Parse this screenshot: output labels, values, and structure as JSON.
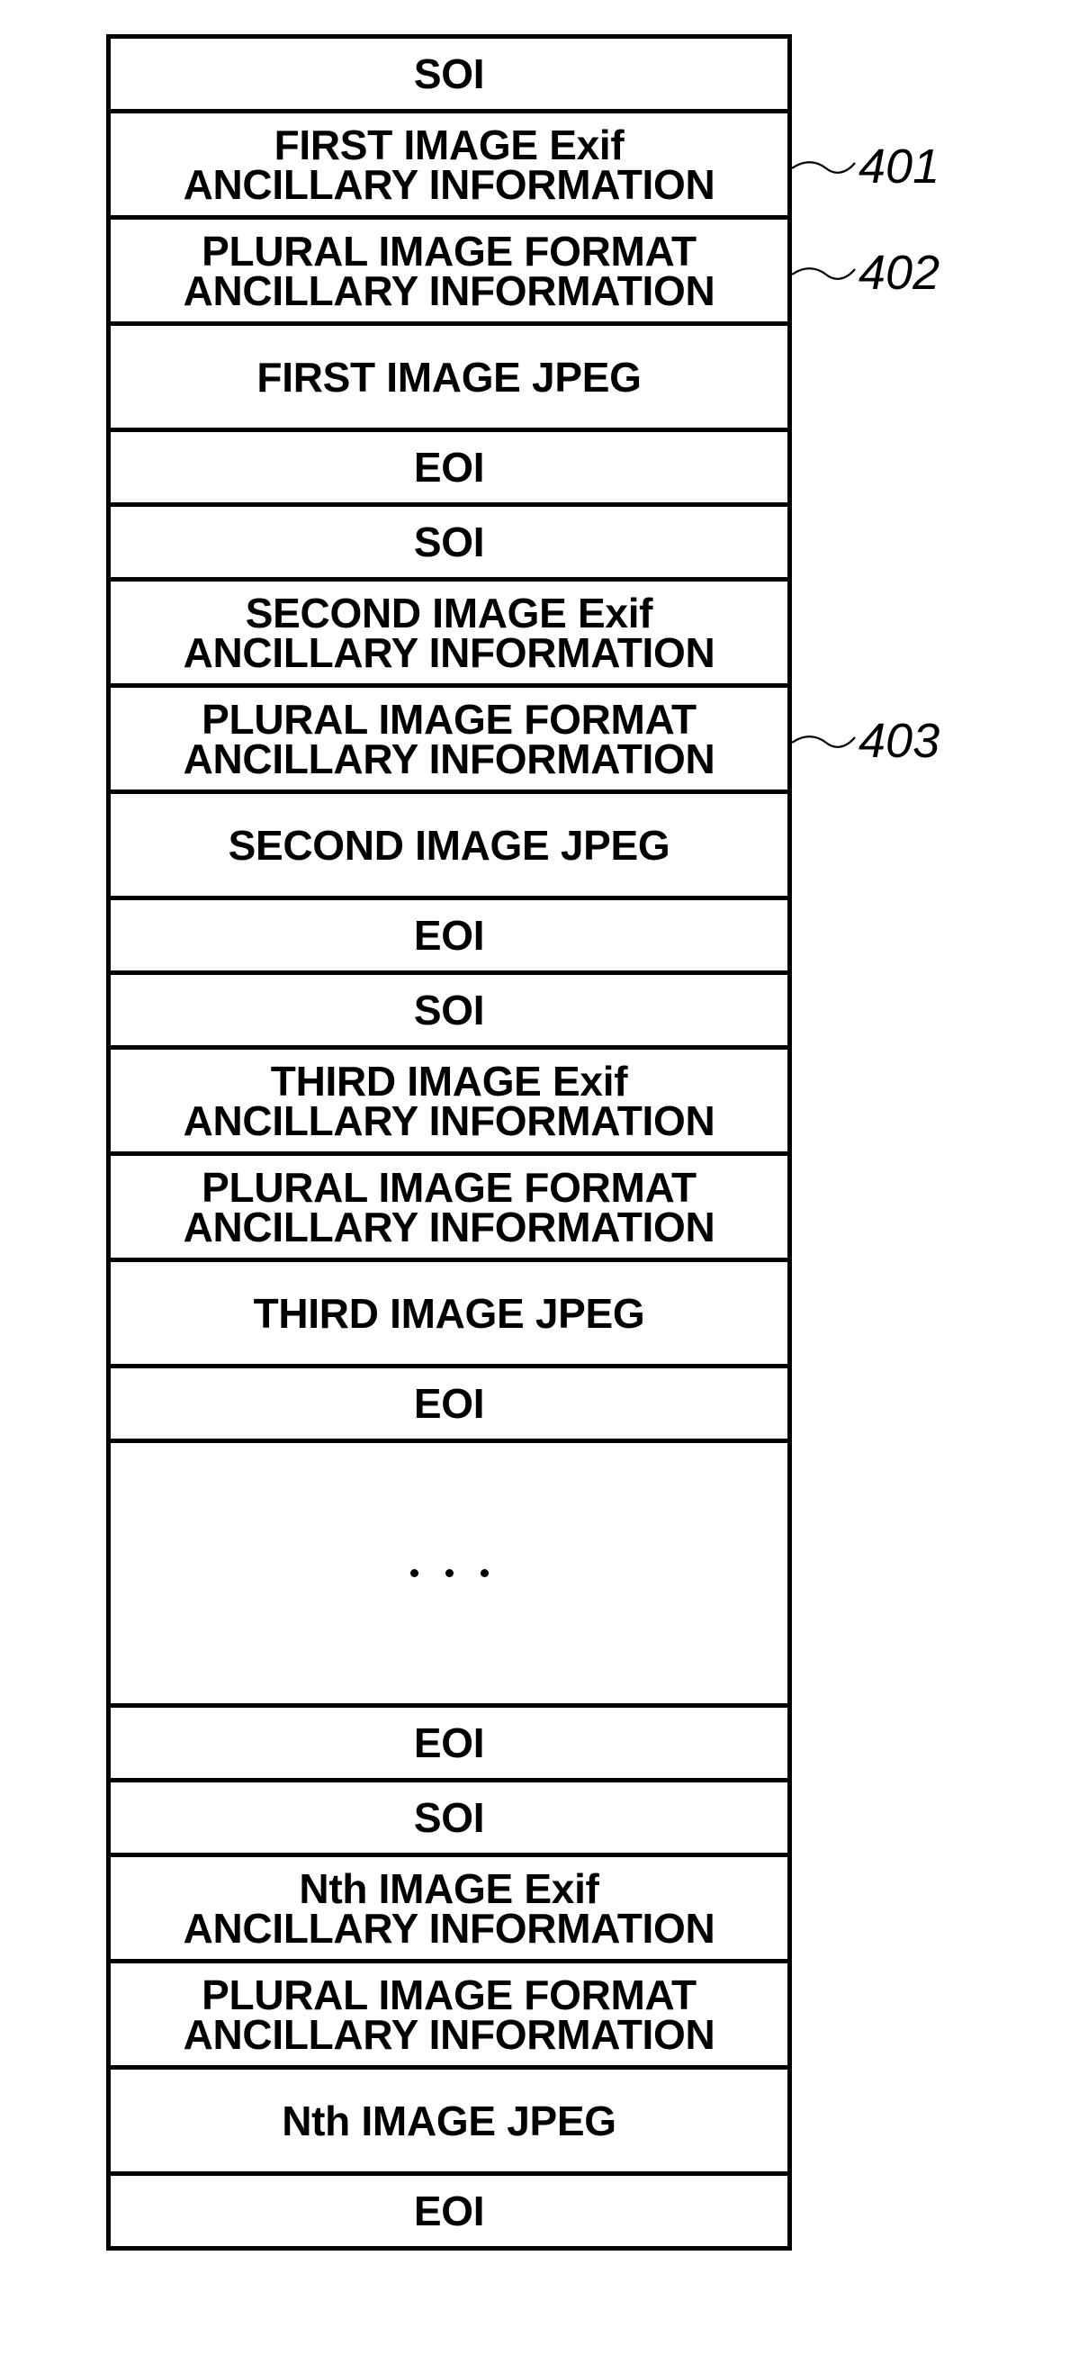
{
  "diagram": {
    "rows": [
      {
        "type": "short",
        "lines": [
          "SOI"
        ]
      },
      {
        "type": "tall",
        "lines": [
          "FIRST IMAGE Exif",
          "ANCILLARY INFORMATION"
        ]
      },
      {
        "type": "tall",
        "lines": [
          "PLURAL IMAGE FORMAT",
          "ANCILLARY INFORMATION"
        ]
      },
      {
        "type": "tall",
        "lines": [
          "FIRST IMAGE JPEG"
        ]
      },
      {
        "type": "short",
        "lines": [
          "EOI"
        ]
      },
      {
        "type": "short",
        "lines": [
          "SOI"
        ]
      },
      {
        "type": "tall",
        "lines": [
          "SECOND IMAGE Exif",
          "ANCILLARY INFORMATION"
        ]
      },
      {
        "type": "tall",
        "lines": [
          "PLURAL IMAGE FORMAT",
          "ANCILLARY INFORMATION"
        ]
      },
      {
        "type": "tall",
        "lines": [
          "SECOND IMAGE JPEG"
        ]
      },
      {
        "type": "short",
        "lines": [
          "EOI"
        ]
      },
      {
        "type": "short",
        "lines": [
          "SOI"
        ]
      },
      {
        "type": "tall",
        "lines": [
          "THIRD IMAGE Exif",
          "ANCILLARY INFORMATION"
        ]
      },
      {
        "type": "tall",
        "lines": [
          "PLURAL IMAGE FORMAT",
          "ANCILLARY INFORMATION"
        ]
      },
      {
        "type": "tall",
        "lines": [
          "THIRD IMAGE JPEG"
        ]
      },
      {
        "type": "short",
        "lines": [
          "EOI"
        ]
      },
      {
        "type": "dots",
        "lines": []
      },
      {
        "type": "short",
        "lines": [
          "EOI"
        ]
      },
      {
        "type": "short",
        "lines": [
          "SOI"
        ]
      },
      {
        "type": "tall",
        "lines": [
          "Nth IMAGE Exif",
          "ANCILLARY INFORMATION"
        ]
      },
      {
        "type": "tall",
        "lines": [
          "PLURAL IMAGE FORMAT",
          "ANCILLARY INFORMATION"
        ]
      },
      {
        "type": "tall",
        "lines": [
          "Nth IMAGE JPEG"
        ]
      },
      {
        "type": "short",
        "lines": [
          "EOI"
        ]
      }
    ],
    "callouts": [
      {
        "ref": "401",
        "row_index": 1
      },
      {
        "ref": "402",
        "row_index": 2
      },
      {
        "ref": "403",
        "row_index": 7
      }
    ],
    "ellipsis_symbol": "· · ·"
  }
}
